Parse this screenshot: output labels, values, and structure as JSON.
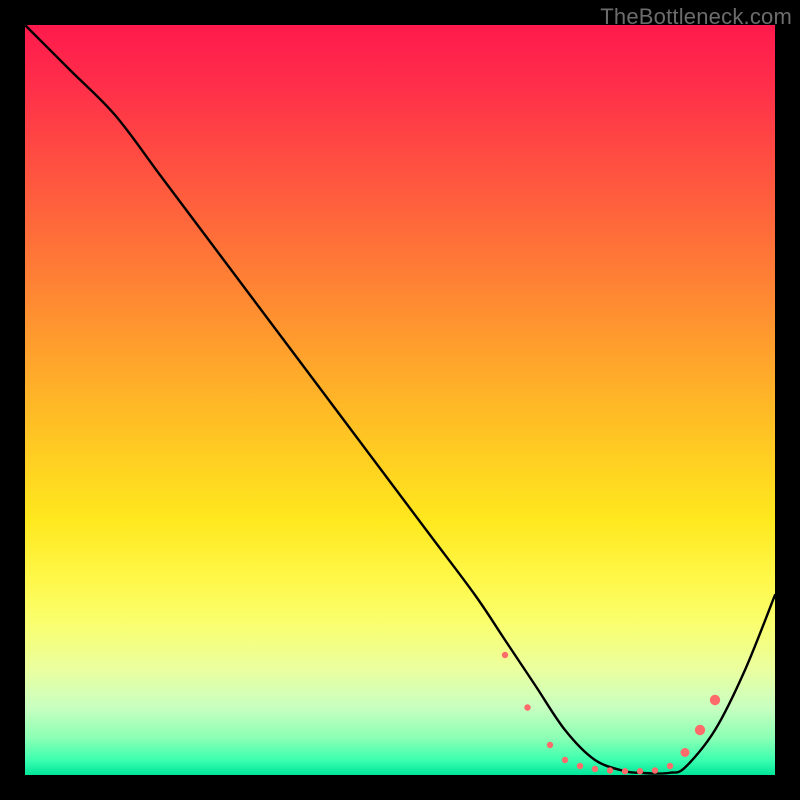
{
  "watermark": "TheBottleneck.com",
  "chart_data": {
    "type": "line",
    "title": "",
    "xlabel": "",
    "ylabel": "",
    "xlim": [
      0,
      100
    ],
    "ylim": [
      0,
      100
    ],
    "series": [
      {
        "name": "curve",
        "x": [
          0,
          6,
          12,
          18,
          24,
          30,
          36,
          42,
          48,
          54,
          60,
          64,
          68,
          72,
          76,
          80,
          82,
          84,
          86,
          88,
          92,
          96,
          100
        ],
        "y": [
          100,
          94,
          88,
          80,
          72,
          64,
          56,
          48,
          40,
          32,
          24,
          18,
          12,
          6,
          2,
          0.5,
          0.3,
          0.2,
          0.3,
          1,
          6,
          14,
          24
        ]
      }
    ],
    "markers": {
      "x": [
        64,
        67,
        70,
        72,
        74,
        76,
        78,
        80,
        82,
        84,
        86,
        88,
        90,
        92
      ],
      "y": [
        16,
        9,
        4,
        2,
        1.2,
        0.8,
        0.6,
        0.5,
        0.5,
        0.6,
        1.2,
        3,
        6,
        10
      ],
      "size": [
        3.2,
        3.2,
        3.2,
        3.2,
        3.2,
        3.2,
        3.2,
        3.2,
        3.2,
        3.2,
        3.2,
        4.5,
        5.2,
        5.2
      ],
      "color": "#ff6a6a"
    }
  }
}
